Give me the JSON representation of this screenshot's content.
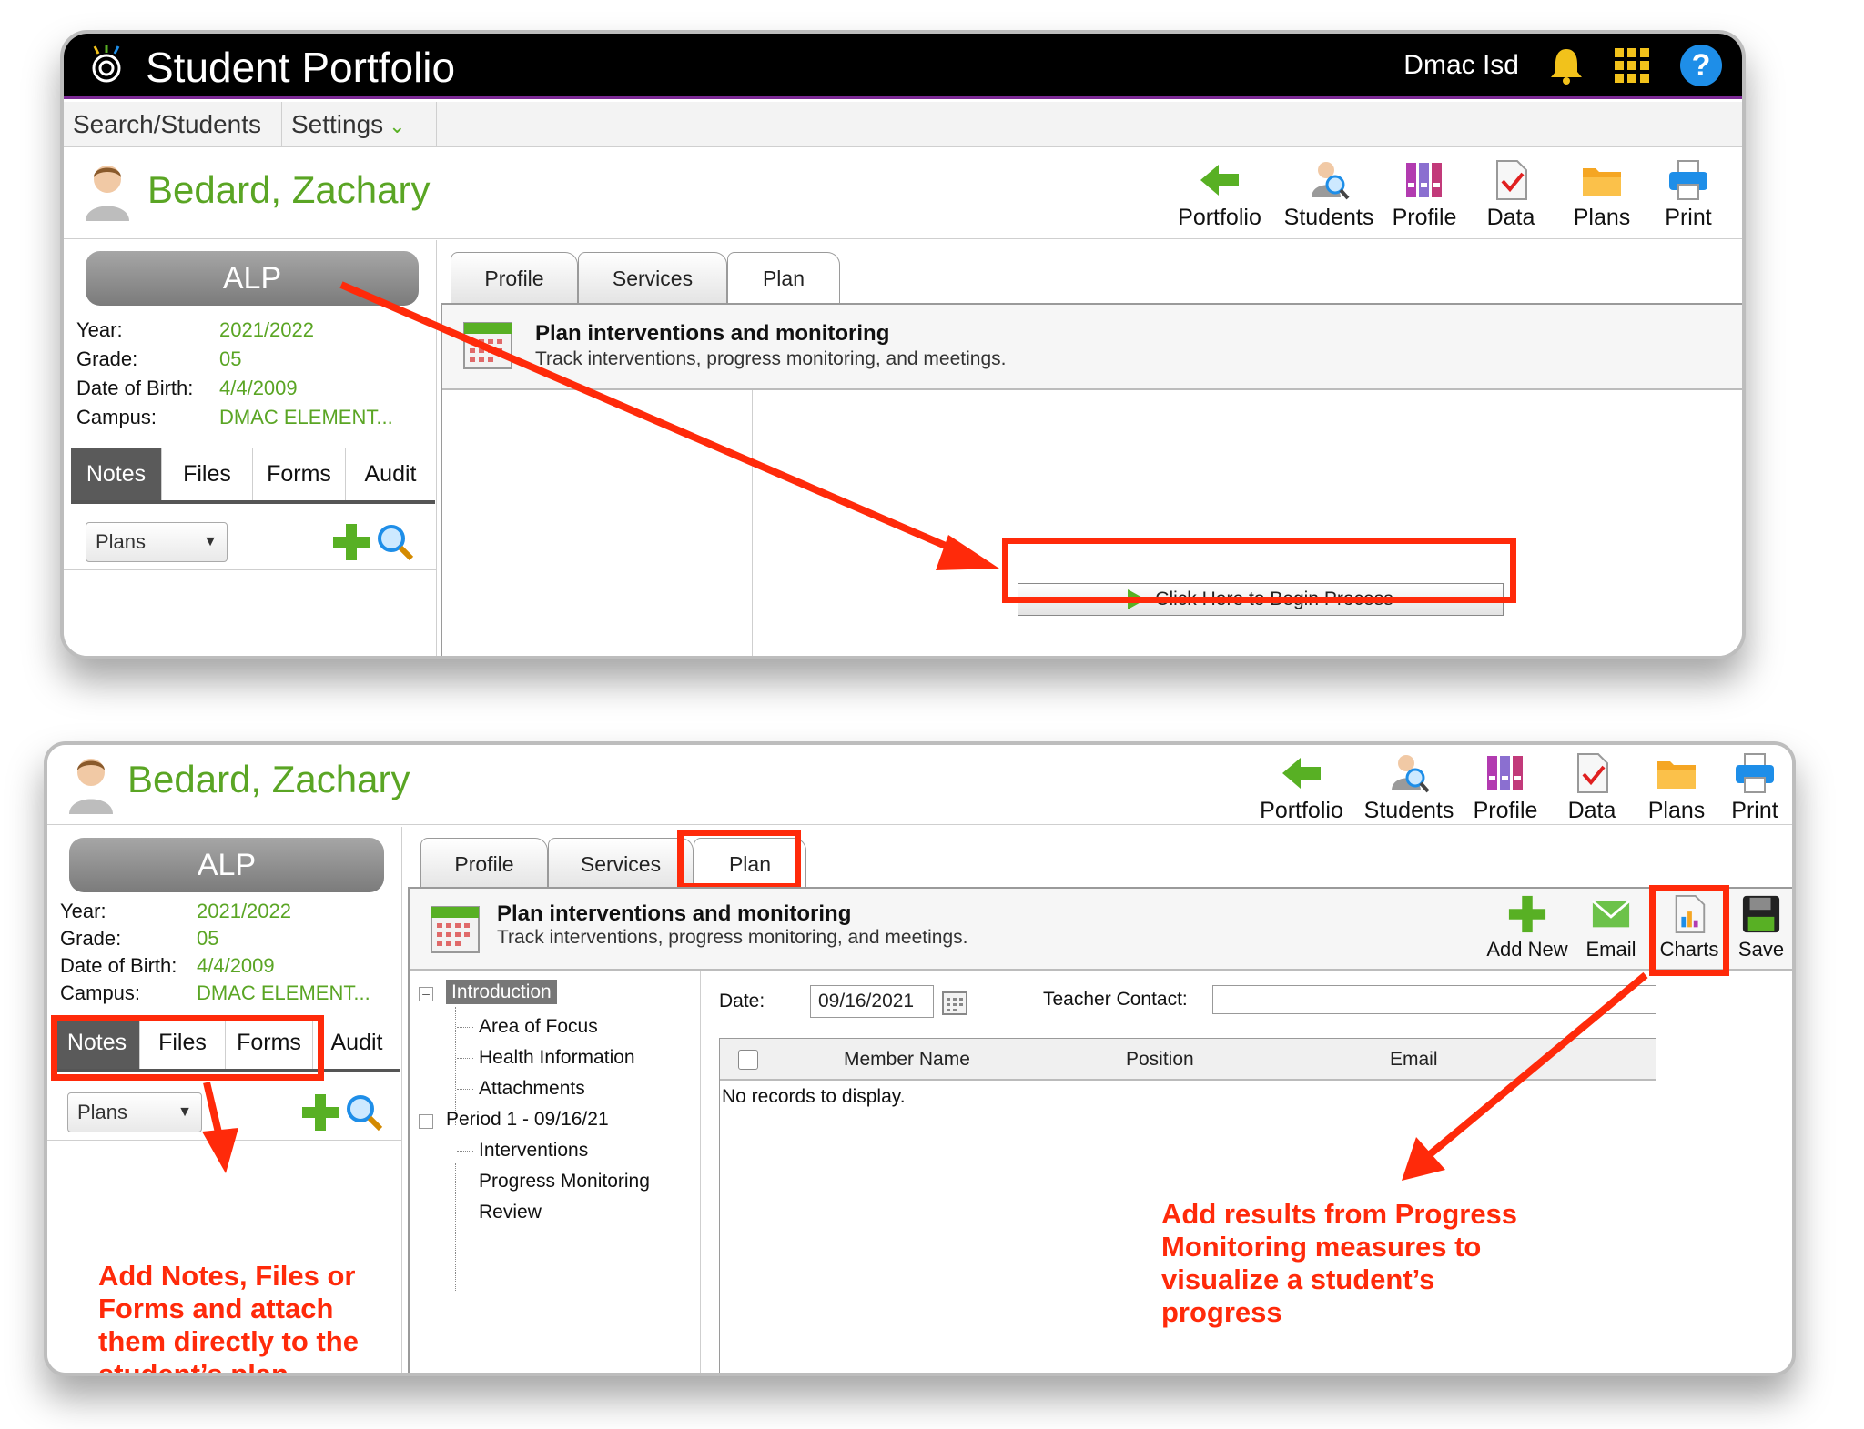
{
  "app": {
    "title": "Student Portfolio",
    "user": "Dmac Isd",
    "menu": [
      "Search/Students",
      "Settings"
    ]
  },
  "student": {
    "name": "Bedard, Zachary",
    "program": "ALP",
    "info": [
      {
        "label": "Year:",
        "value": "2021/2022"
      },
      {
        "label": "Grade:",
        "value": "05"
      },
      {
        "label": "Date of Birth:",
        "value": "4/4/2009"
      },
      {
        "label": "Campus:",
        "value": "DMAC ELEMENT..."
      }
    ]
  },
  "toolbar": [
    "Portfolio",
    "Students",
    "Profile",
    "Data",
    "Plans",
    "Print"
  ],
  "left_tabs": [
    "Notes",
    "Files",
    "Forms",
    "Audit"
  ],
  "left_select": "Plans",
  "content_tabs": [
    "Profile",
    "Services",
    "Plan"
  ],
  "plan": {
    "title": "Plan interventions and monitoring",
    "subtitle": "Track interventions, progress monitoring, and meetings.",
    "begin_button": "Click Here to Begin Process",
    "actions": [
      "Add New",
      "Email",
      "Charts",
      "Save"
    ]
  },
  "tree": {
    "items": [
      "Introduction",
      "Area of Focus",
      "Health Information",
      "Attachments",
      "Period 1 - 09/16/21",
      "Interventions",
      "Progress Monitoring",
      "Review"
    ]
  },
  "form": {
    "date_label": "Date:",
    "date_value": "09/16/2021",
    "teacher_label": "Teacher Contact:",
    "teacher_value": "",
    "columns": [
      "Member Name",
      "Position",
      "Email"
    ],
    "empty": "No records to display."
  },
  "annotations": {
    "left": "Add Notes, Files or Forms and attach them directly to the student’s plan",
    "right": "Add results from Progress Monitoring measures to visualize a student’s progress"
  },
  "colors": {
    "accent_green": "#5aa524",
    "highlight_red": "#ff2a0a",
    "header_black": "#000000"
  }
}
